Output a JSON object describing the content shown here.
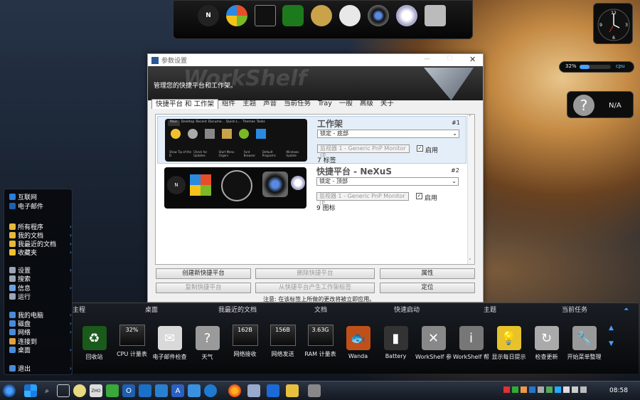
{
  "dialog": {
    "title": "参数设置",
    "subtitle": "管理您的快捷平台和工作架。",
    "watermark": "WorkShelf",
    "tabs": [
      "快捷平台 和 工作架",
      "组件",
      "主题",
      "声音",
      "当前任务",
      "Tray",
      "一般",
      "高级",
      "关于"
    ],
    "items": [
      {
        "name": "工作架",
        "index": "#1",
        "lock": "锁定 - 底部",
        "monitor": "监视器 1 - Generic PnP Monitor (P",
        "enable": "启用",
        "count": "7 标签",
        "preview_tabs": [
          "Main",
          "Desktop",
          "Recent",
          "Docume...",
          "Quick L...",
          "Themes",
          "Tasks"
        ],
        "preview_labels": [
          "Show Tip of the D",
          "Check for Updates",
          "Start Menu Organi",
          "Font Browser",
          "Default Programs",
          "Windows Update"
        ]
      },
      {
        "name": "快捷平台 - NeXuS",
        "index": "#2",
        "lock": "锁定 - 顶部",
        "monitor": "监视器 1 - Generic PnP Monitor (P",
        "enable": "启用",
        "count": "9 图标"
      }
    ],
    "buttons": {
      "create": "创建新快捷平台",
      "delete": "删除快捷平台",
      "props": "属性",
      "copy": "复制快捷平台",
      "from_tab": "从快捷平台产生工作架标签",
      "locate": "定位"
    },
    "note": "注意: 在该标签上所做的更改将被立即应用。"
  },
  "widgets": {
    "cpu_percent": "32%",
    "cpu_label": "cpu",
    "cpu_fill": 0.32,
    "weather": "N/A",
    "clock_ticks": [
      "12",
      "3",
      "6",
      "9"
    ]
  },
  "start_menu": {
    "top": [
      {
        "label": "互联网",
        "icon": "ie-icon",
        "color": "#2b7fd8"
      },
      {
        "label": "电子邮件",
        "icon": "outlook-icon",
        "color": "#1f5fb0"
      }
    ],
    "items": [
      {
        "label": "所有程序",
        "icon": "folder-icon",
        "color": "#e7b93a",
        "arrow": true
      },
      {
        "label": "我的文档",
        "icon": "folder-icon",
        "color": "#e7b93a",
        "arrow": true
      },
      {
        "label": "我最近的文档",
        "icon": "folder-icon",
        "color": "#e7b93a",
        "arrow": true
      },
      {
        "label": "收藏夹",
        "icon": "star-icon",
        "color": "#f2c12e",
        "arrow": true
      },
      {
        "label": "设置",
        "icon": "gear-icon",
        "color": "#9aa6b4",
        "arrow": true
      },
      {
        "label": "搜索",
        "icon": "search-icon",
        "color": "#9aa6b4",
        "arrow": false
      },
      {
        "label": "信息",
        "icon": "info-icon",
        "color": "#6aa0e0",
        "arrow": true
      },
      {
        "label": "运行",
        "icon": "run-icon",
        "color": "#9aa6b4",
        "arrow": false
      },
      {
        "label": "我的电脑",
        "icon": "computer-icon",
        "color": "#4a8ad8",
        "arrow": true
      },
      {
        "label": "磁盘",
        "icon": "disk-icon",
        "color": "#4a8ad8",
        "arrow": true
      },
      {
        "label": "网络",
        "icon": "network-icon",
        "color": "#4a8ad8",
        "arrow": true
      },
      {
        "label": "连接到",
        "icon": "connect-icon",
        "color": "#e0a040",
        "arrow": false
      },
      {
        "label": "桌面",
        "icon": "desktop-icon",
        "color": "#4a8ad8",
        "arrow": true
      },
      {
        "label": "退出",
        "icon": "exit-icon",
        "color": "#4a8ad8",
        "arrow": true
      }
    ]
  },
  "shelf": {
    "tabs": [
      "主程",
      "桌面",
      "我最近的文档",
      "文档",
      "快速启动",
      "主题",
      "当前任务"
    ],
    "items": [
      {
        "label": "回收站",
        "kind": "icon",
        "glyph": "♻",
        "color": "#1a5a1a"
      },
      {
        "label": "CPU 计量表",
        "kind": "meter",
        "value": "32%"
      },
      {
        "label": "电子邮件检查",
        "kind": "icon",
        "glyph": "✉",
        "color": "#d9d9d9"
      },
      {
        "label": "天气",
        "kind": "icon",
        "glyph": "?",
        "color": "#9a9a9a",
        "sub": "N/A"
      },
      {
        "label": "网络接收",
        "kind": "meter",
        "value": "162B"
      },
      {
        "label": "网络发送",
        "kind": "meter",
        "value": "156B"
      },
      {
        "label": "RAM 计量表",
        "kind": "meter",
        "value": "3.63G"
      },
      {
        "label": "Wanda",
        "kind": "icon",
        "glyph": "🐟",
        "color": "#c0501a"
      },
      {
        "label": "Battery",
        "kind": "icon",
        "glyph": "▮",
        "color": "#333"
      },
      {
        "label": "WorkShelf 参",
        "kind": "icon",
        "glyph": "✕",
        "color": "#888"
      },
      {
        "label": "WorkShelf 帮",
        "kind": "icon",
        "glyph": "i",
        "color": "#777"
      },
      {
        "label": "显示每日提示",
        "kind": "icon",
        "glyph": "💡",
        "color": "#e8c22a"
      },
      {
        "label": "检查更新",
        "kind": "icon",
        "glyph": "↻",
        "color": "#aaa"
      },
      {
        "label": "开始菜单整理",
        "kind": "icon",
        "glyph": "🔧",
        "color": "#999"
      }
    ]
  },
  "taskbar": {
    "time": "08:58"
  }
}
